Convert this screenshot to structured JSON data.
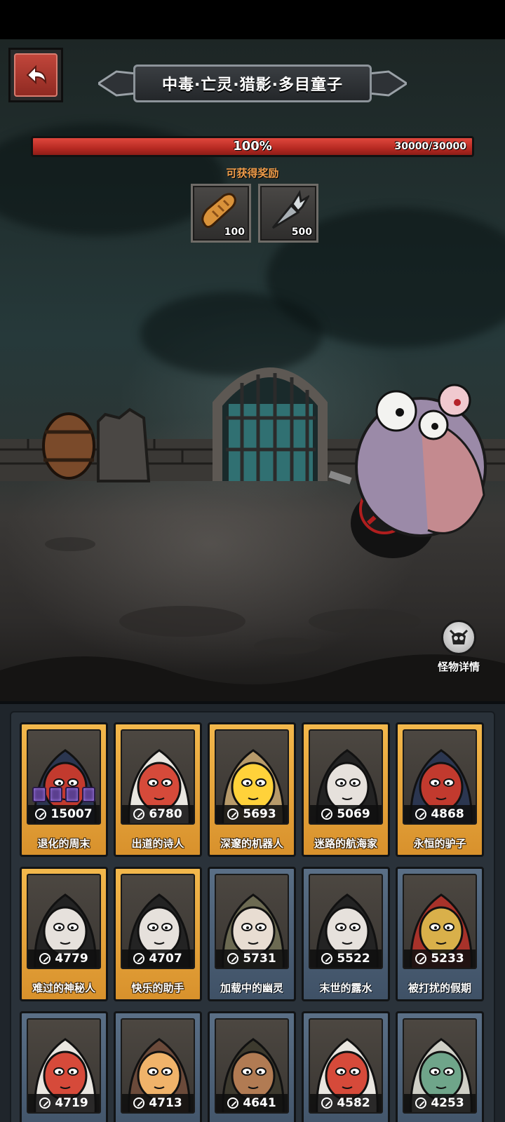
{
  "header": {
    "title": "中毒·亡灵·猎影·多目童子"
  },
  "boss": {
    "hp_percent_label": "100%",
    "hp_value_label": "30000/30000",
    "hp_fraction": 1.0
  },
  "rewards": {
    "label": "可获得奖励",
    "items": [
      {
        "icon": "bread-icon",
        "qty": "100"
      },
      {
        "icon": "carrot-icon",
        "qty": "500"
      }
    ]
  },
  "monster_detail": {
    "label": "怪物详情"
  },
  "roster": {
    "cards": [
      {
        "name": "退化的周末",
        "power": "15007",
        "rarity": "gold"
      },
      {
        "name": "出道的诗人",
        "power": "6780",
        "rarity": "gold"
      },
      {
        "name": "深邃的机器人",
        "power": "5693",
        "rarity": "gold"
      },
      {
        "name": "迷路的航海家",
        "power": "5069",
        "rarity": "gold"
      },
      {
        "name": "永恒的驴子",
        "power": "4868",
        "rarity": "gold"
      },
      {
        "name": "难过的神秘人",
        "power": "4779",
        "rarity": "gold"
      },
      {
        "name": "快乐的助手",
        "power": "4707",
        "rarity": "gold"
      },
      {
        "name": "加载中的幽灵",
        "power": "5731",
        "rarity": "blue"
      },
      {
        "name": "末世的露水",
        "power": "5522",
        "rarity": "blue"
      },
      {
        "name": "被打扰的假期",
        "power": "5233",
        "rarity": "blue"
      },
      {
        "name": "",
        "power": "4719",
        "rarity": "blue"
      },
      {
        "name": "",
        "power": "4713",
        "rarity": "blue"
      },
      {
        "name": "",
        "power": "4641",
        "rarity": "blue"
      },
      {
        "name": "",
        "power": "4582",
        "rarity": "blue"
      },
      {
        "name": "",
        "power": "4253",
        "rarity": "blue"
      }
    ]
  },
  "colors": {
    "hp_red": "#c3342b",
    "reward_label": "#ef9c4a",
    "card_gold": "#e6a23a",
    "card_blue": "#4d6076"
  }
}
